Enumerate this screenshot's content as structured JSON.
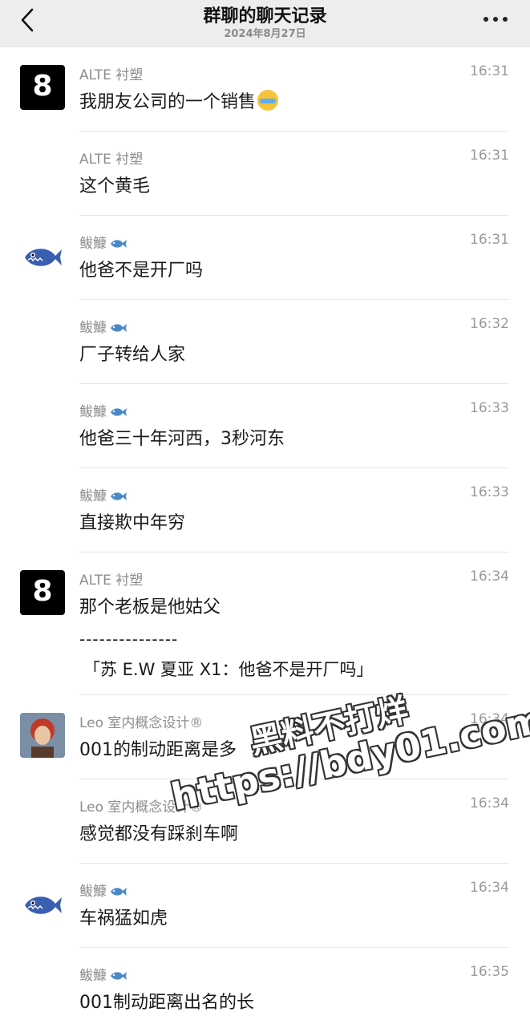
{
  "header": {
    "title": "群聊的聊天记录",
    "date": "2024年8月27日"
  },
  "icons": {
    "back": "chevron-left-icon",
    "more": "more-dots-icon",
    "fish": "fish-emoji-icon",
    "tears_face": "rolling-laughing-emoji-icon"
  },
  "colors": {
    "header_bg": "#ededed",
    "name": "#8d8d8d",
    "time": "#9a9a9a"
  },
  "messages": [
    {
      "sender": "ALTE 衬塑",
      "avatar_text": "8",
      "time": "16:31",
      "text": "我朋友公司的一个销售"
    },
    {
      "sender": "ALTE 衬塑",
      "time": "16:31",
      "text": "这个黄毛"
    },
    {
      "sender": "鲅鱇",
      "time": "16:31",
      "text": "他爸不是开厂吗"
    },
    {
      "sender": "鲅鱇",
      "time": "16:32",
      "text": "厂子转给人家"
    },
    {
      "sender": "鲅鱇",
      "time": "16:33",
      "text": "他爸三十年河西，3秒河东"
    },
    {
      "sender": "鲅鱇",
      "time": "16:33",
      "text": "直接欺中年穷"
    },
    {
      "sender": "ALTE 衬塑",
      "avatar_text": "8",
      "time": "16:34",
      "text": "那个老板是他姑父",
      "dash": "---------------",
      "quote": "「苏 E.W 夏亚 X1：他爸不是开厂吗」"
    },
    {
      "sender": "Leo  室内概念设计®",
      "time": "16:34",
      "text": "001的制动距离是多"
    },
    {
      "sender": "Leo  室内概念设计®",
      "time": "16:34",
      "text": "感觉都没有踩刹车啊"
    },
    {
      "sender": "鲅鱇",
      "time": "16:34",
      "text": "车祸猛如虎"
    },
    {
      "sender": "鲅鱇",
      "time": "16:35",
      "text": "001制动距离出名的长"
    }
  ],
  "watermark": {
    "line1": "黑料不打烊",
    "line2": "https://bdy01.com"
  }
}
